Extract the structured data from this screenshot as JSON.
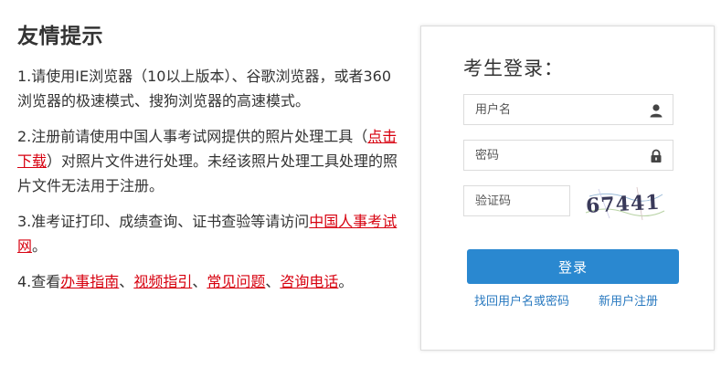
{
  "tips": {
    "title": "友情提示",
    "item1": "1.请使用IE浏览器（10以上版本）、谷歌浏览器，或者360浏览器的极速模式、搜狗浏览器的高速模式。",
    "item2_prefix": "2.注册前请使用中国人事考试网提供的照片处理工具（",
    "item2_link": "点击下载",
    "item2_suffix": "）对照片文件进行处理。未经该照片处理工具处理的照片文件无法用于注册。",
    "item3_prefix": "3.准考证打印、成绩查询、证书查验等请访问",
    "item3_link": "中国人事考试网",
    "item3_suffix": "。",
    "item4_prefix": "4.查看",
    "item4_link1": "办事指南",
    "sep": "、",
    "item4_link2": "视频指引",
    "item4_link3": "常见问题",
    "item4_link4": "咨询电话",
    "item4_suffix": "。"
  },
  "login": {
    "title": "考生登录：",
    "username_placeholder": "用户名",
    "password_placeholder": "密码",
    "captcha_placeholder": "验证码",
    "captcha_text": "67441",
    "button_label": "登录",
    "recover_link": "找回用户名或密码",
    "register_link": "新用户注册",
    "user_icon": "user-icon",
    "lock_icon": "lock-icon"
  },
  "colors": {
    "link_red": "#d7000f",
    "button_blue": "#2a88d0",
    "link_blue": "#2a7ac0",
    "text": "#333333"
  }
}
